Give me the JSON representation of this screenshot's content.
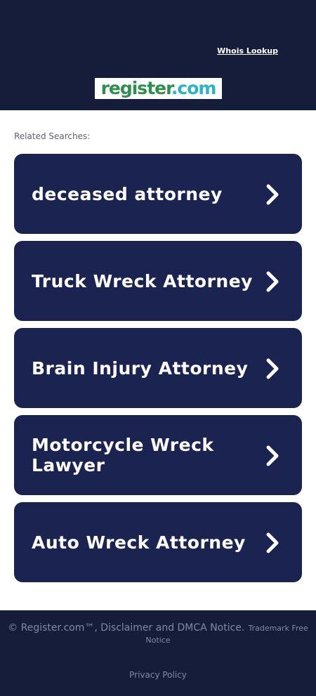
{
  "header": {
    "whois_link": "Whois Lookup",
    "logo_main": "register",
    "logo_dotcom": ".com",
    "logo_tm": "®",
    "background": "#161d3a"
  },
  "related_searches_label": "Related Searches:",
  "cards": [
    {
      "label": "deceased attorney"
    },
    {
      "label": "Truck Wreck Attorney"
    },
    {
      "label": "Brain Injury Attorney"
    },
    {
      "label": "Motorcycle Wreck Lawyer"
    },
    {
      "label": "Auto Wreck Attorney"
    }
  ],
  "card_color": "#1b2350",
  "chevron_icon": "chevron-right-icon",
  "footer": {
    "copyright": "© Register.com™, Disclaimer and DMCA Notice.",
    "trademark": "Trademark Free Notice",
    "privacy": "Privacy Policy"
  }
}
